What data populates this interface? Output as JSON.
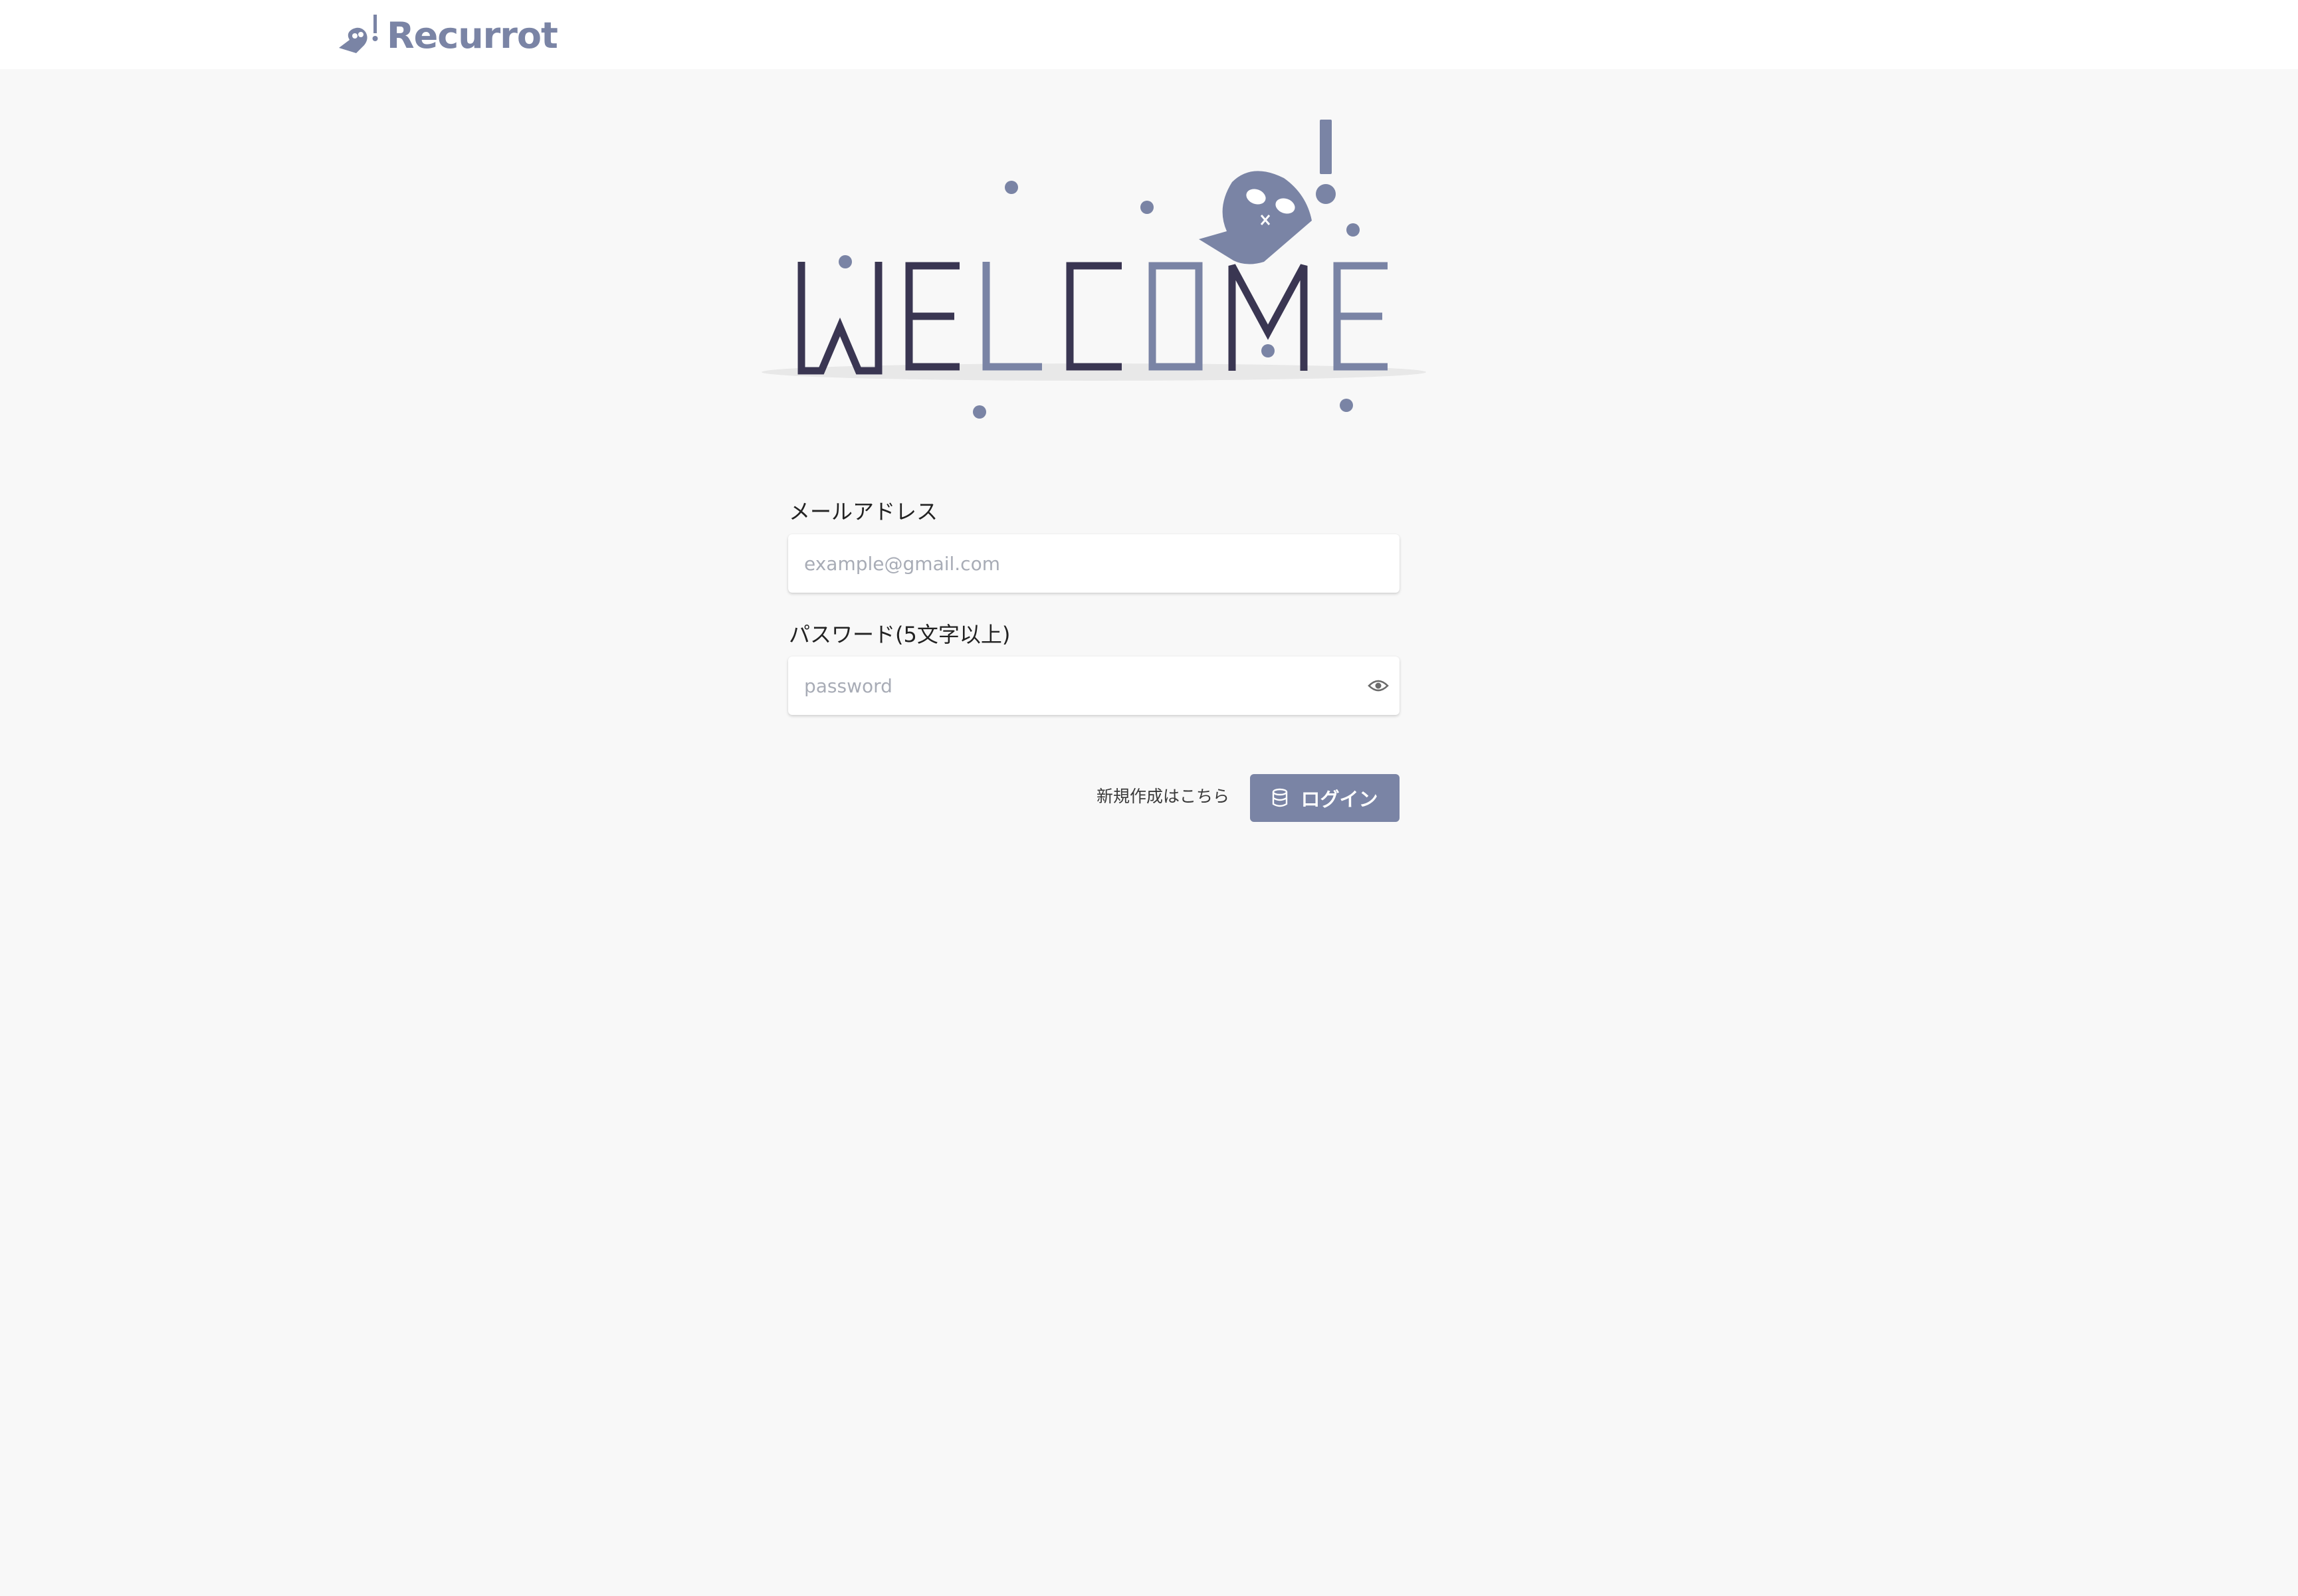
{
  "app": {
    "name": "Recurrot",
    "logo_icon": "parrot-icon"
  },
  "hero": {
    "welcome_text": "WELCOME"
  },
  "form": {
    "email_label": "メールアドレス",
    "email_placeholder": "example@gmail.com",
    "email_value": "",
    "password_label": "パスワード(5文字以上)",
    "password_placeholder": "password",
    "password_value": "",
    "password_toggle_icon": "eye-icon",
    "signup_link": "新規作成はこちら",
    "login_button": "ログイン",
    "login_button_icon": "database-icon"
  },
  "colors": {
    "accent": "#7a84a5",
    "dark_letters": "#3a3652",
    "background": "#f8f8f8",
    "header_bg": "#ffffff"
  }
}
